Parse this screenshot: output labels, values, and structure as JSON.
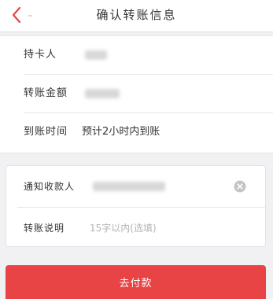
{
  "header": {
    "title": "确认转账信息",
    "back_icon": "chevron-left-icon",
    "accent_color": "#e84446"
  },
  "transfer_info": {
    "cardholder": {
      "label": "持卡人"
    },
    "amount": {
      "label": "转账金额"
    },
    "arrival_time": {
      "label": "到账时间",
      "value": "预计2小时内到账"
    }
  },
  "form": {
    "notify_payee": {
      "label": "通知收款人",
      "clear_icon": "clear-icon"
    },
    "remark": {
      "label": "转账说明",
      "placeholder": "15字以内(选填)"
    }
  },
  "actions": {
    "pay_label": "去付款",
    "pay_color": "#e84446"
  }
}
